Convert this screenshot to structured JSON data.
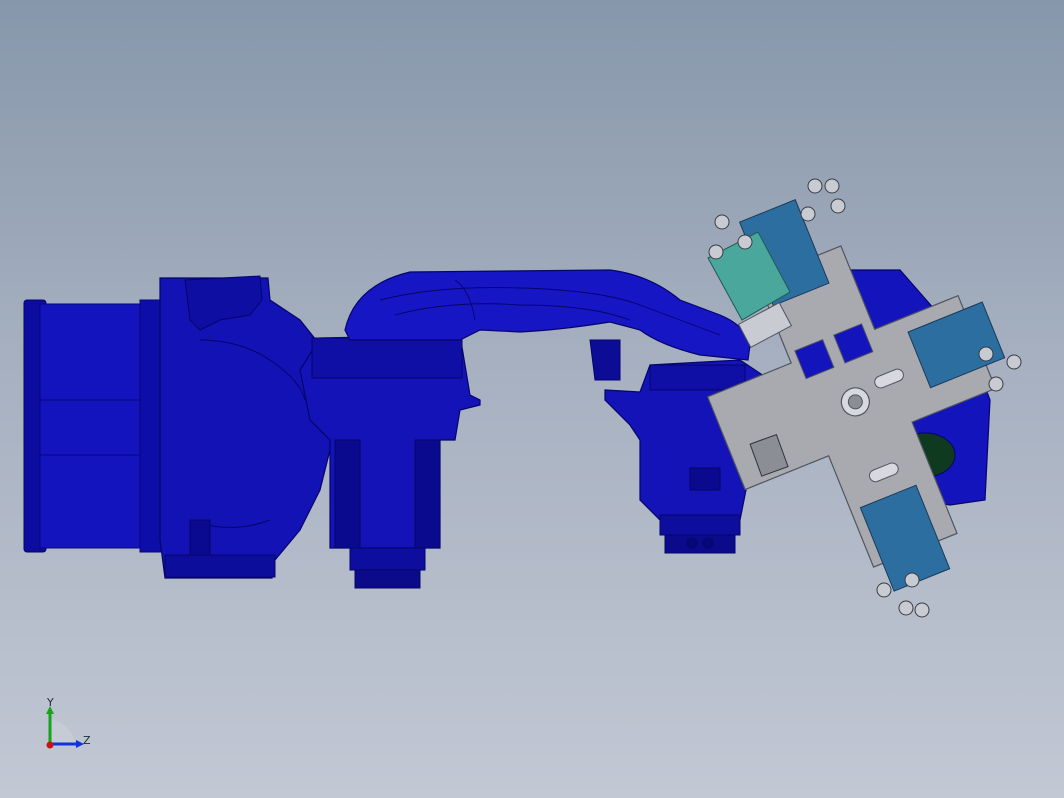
{
  "viewport": {
    "background_top": "#8797ab",
    "background_bottom": "#c2c8d4"
  },
  "model": {
    "body_color": "#1010b8",
    "body_shade": "#07077e",
    "plate_color": "#a9aab0",
    "blue_plate_color": "#2d6ea0",
    "teal_plate_color": "#4aa79c",
    "wheel_color": "#c9cbd2"
  },
  "triad": {
    "y_label": "Y",
    "z_label": "Z",
    "y_color": "#17a21b",
    "z_color": "#1133dd",
    "origin_color": "#cc1111"
  }
}
